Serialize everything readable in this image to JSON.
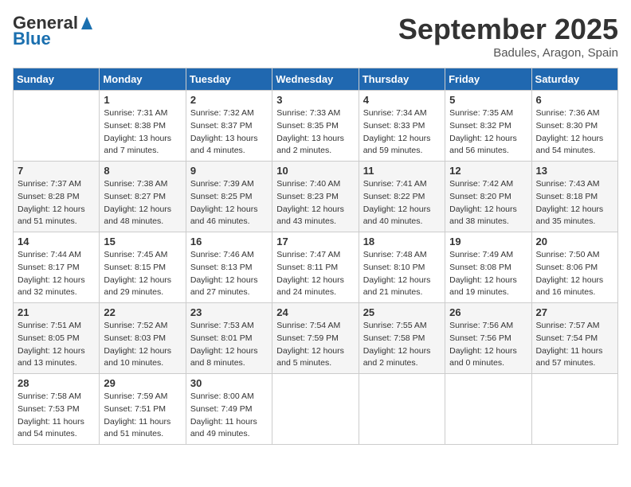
{
  "header": {
    "logo_line1": "General",
    "logo_line2": "Blue",
    "month": "September 2025",
    "location": "Badules, Aragon, Spain"
  },
  "weekdays": [
    "Sunday",
    "Monday",
    "Tuesday",
    "Wednesday",
    "Thursday",
    "Friday",
    "Saturday"
  ],
  "weeks": [
    [
      {
        "day": "",
        "info": ""
      },
      {
        "day": "1",
        "info": "Sunrise: 7:31 AM\nSunset: 8:38 PM\nDaylight: 13 hours\nand 7 minutes."
      },
      {
        "day": "2",
        "info": "Sunrise: 7:32 AM\nSunset: 8:37 PM\nDaylight: 13 hours\nand 4 minutes."
      },
      {
        "day": "3",
        "info": "Sunrise: 7:33 AM\nSunset: 8:35 PM\nDaylight: 13 hours\nand 2 minutes."
      },
      {
        "day": "4",
        "info": "Sunrise: 7:34 AM\nSunset: 8:33 PM\nDaylight: 12 hours\nand 59 minutes."
      },
      {
        "day": "5",
        "info": "Sunrise: 7:35 AM\nSunset: 8:32 PM\nDaylight: 12 hours\nand 56 minutes."
      },
      {
        "day": "6",
        "info": "Sunrise: 7:36 AM\nSunset: 8:30 PM\nDaylight: 12 hours\nand 54 minutes."
      }
    ],
    [
      {
        "day": "7",
        "info": "Sunrise: 7:37 AM\nSunset: 8:28 PM\nDaylight: 12 hours\nand 51 minutes."
      },
      {
        "day": "8",
        "info": "Sunrise: 7:38 AM\nSunset: 8:27 PM\nDaylight: 12 hours\nand 48 minutes."
      },
      {
        "day": "9",
        "info": "Sunrise: 7:39 AM\nSunset: 8:25 PM\nDaylight: 12 hours\nand 46 minutes."
      },
      {
        "day": "10",
        "info": "Sunrise: 7:40 AM\nSunset: 8:23 PM\nDaylight: 12 hours\nand 43 minutes."
      },
      {
        "day": "11",
        "info": "Sunrise: 7:41 AM\nSunset: 8:22 PM\nDaylight: 12 hours\nand 40 minutes."
      },
      {
        "day": "12",
        "info": "Sunrise: 7:42 AM\nSunset: 8:20 PM\nDaylight: 12 hours\nand 38 minutes."
      },
      {
        "day": "13",
        "info": "Sunrise: 7:43 AM\nSunset: 8:18 PM\nDaylight: 12 hours\nand 35 minutes."
      }
    ],
    [
      {
        "day": "14",
        "info": "Sunrise: 7:44 AM\nSunset: 8:17 PM\nDaylight: 12 hours\nand 32 minutes."
      },
      {
        "day": "15",
        "info": "Sunrise: 7:45 AM\nSunset: 8:15 PM\nDaylight: 12 hours\nand 29 minutes."
      },
      {
        "day": "16",
        "info": "Sunrise: 7:46 AM\nSunset: 8:13 PM\nDaylight: 12 hours\nand 27 minutes."
      },
      {
        "day": "17",
        "info": "Sunrise: 7:47 AM\nSunset: 8:11 PM\nDaylight: 12 hours\nand 24 minutes."
      },
      {
        "day": "18",
        "info": "Sunrise: 7:48 AM\nSunset: 8:10 PM\nDaylight: 12 hours\nand 21 minutes."
      },
      {
        "day": "19",
        "info": "Sunrise: 7:49 AM\nSunset: 8:08 PM\nDaylight: 12 hours\nand 19 minutes."
      },
      {
        "day": "20",
        "info": "Sunrise: 7:50 AM\nSunset: 8:06 PM\nDaylight: 12 hours\nand 16 minutes."
      }
    ],
    [
      {
        "day": "21",
        "info": "Sunrise: 7:51 AM\nSunset: 8:05 PM\nDaylight: 12 hours\nand 13 minutes."
      },
      {
        "day": "22",
        "info": "Sunrise: 7:52 AM\nSunset: 8:03 PM\nDaylight: 12 hours\nand 10 minutes."
      },
      {
        "day": "23",
        "info": "Sunrise: 7:53 AM\nSunset: 8:01 PM\nDaylight: 12 hours\nand 8 minutes."
      },
      {
        "day": "24",
        "info": "Sunrise: 7:54 AM\nSunset: 7:59 PM\nDaylight: 12 hours\nand 5 minutes."
      },
      {
        "day": "25",
        "info": "Sunrise: 7:55 AM\nSunset: 7:58 PM\nDaylight: 12 hours\nand 2 minutes."
      },
      {
        "day": "26",
        "info": "Sunrise: 7:56 AM\nSunset: 7:56 PM\nDaylight: 12 hours\nand 0 minutes."
      },
      {
        "day": "27",
        "info": "Sunrise: 7:57 AM\nSunset: 7:54 PM\nDaylight: 11 hours\nand 57 minutes."
      }
    ],
    [
      {
        "day": "28",
        "info": "Sunrise: 7:58 AM\nSunset: 7:53 PM\nDaylight: 11 hours\nand 54 minutes."
      },
      {
        "day": "29",
        "info": "Sunrise: 7:59 AM\nSunset: 7:51 PM\nDaylight: 11 hours\nand 51 minutes."
      },
      {
        "day": "30",
        "info": "Sunrise: 8:00 AM\nSunset: 7:49 PM\nDaylight: 11 hours\nand 49 minutes."
      },
      {
        "day": "",
        "info": ""
      },
      {
        "day": "",
        "info": ""
      },
      {
        "day": "",
        "info": ""
      },
      {
        "day": "",
        "info": ""
      }
    ]
  ]
}
